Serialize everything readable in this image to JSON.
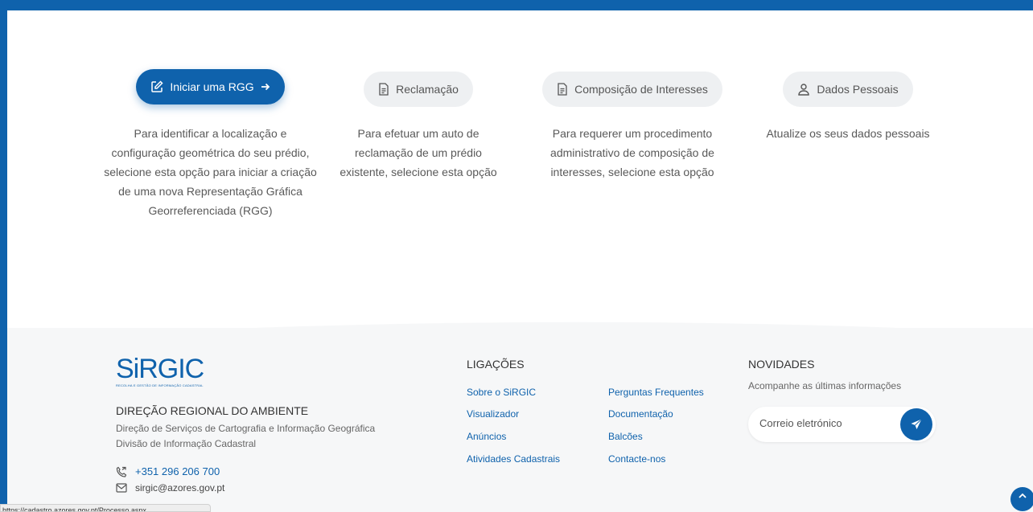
{
  "options": [
    {
      "label": "Iniciar uma RGG",
      "icon": "edit-icon",
      "primary": true,
      "description": "Para identificar a localização e configuração geométrica do seu prédio, selecione esta opção para iniciar a criação de uma nova Representação Gráfica Georreferenciada (RGG)"
    },
    {
      "label": "Reclamação",
      "icon": "document-icon",
      "primary": false,
      "description": "Para efetuar um auto de reclamação de um prédio existente, selecione esta opção"
    },
    {
      "label": "Composição de Interesses",
      "icon": "document-icon",
      "primary": false,
      "description": "Para requerer um procedimento administrativo de composição de interesses, selecione esta opção"
    },
    {
      "label": "Dados Pessoais",
      "icon": "user-icon",
      "primary": false,
      "description": "Atualize os seus dados pessoais"
    }
  ],
  "footer": {
    "logo_text": "SiRGIC",
    "logo_subtitle": "RECOLHA E GESTÃO DE INFORMAÇÃO CADASTRAL",
    "org_name": "DIREÇÃO REGIONAL DO AMBIENTE",
    "org_line1": "Direção de Serviços de Cartografia e Informação Geográfica",
    "org_line2": "Divisão de Informação Cadastral",
    "phone": "+351 296 206 700",
    "email": "sirgic@azores.gov.pt",
    "links_title": "LIGAÇÕES",
    "links_col1": [
      "Sobre o SiRGIC",
      "Visualizador",
      "Anúncios",
      "Atividades Cadastrais"
    ],
    "links_col2": [
      "Perguntas Frequentes",
      "Documentação",
      "Balcões",
      "Contacte-nos"
    ],
    "news_title": "NOVIDADES",
    "news_text": "Acompanhe as últimas informações",
    "news_placeholder": "Correio eletrónico"
  },
  "status_url": "https://cadastro.azores.gov.pt/Processo.aspx",
  "colors": {
    "brand": "#0f62ac",
    "button_secondary": "#eef0f2",
    "footer_bg": "#f6f7f8"
  }
}
